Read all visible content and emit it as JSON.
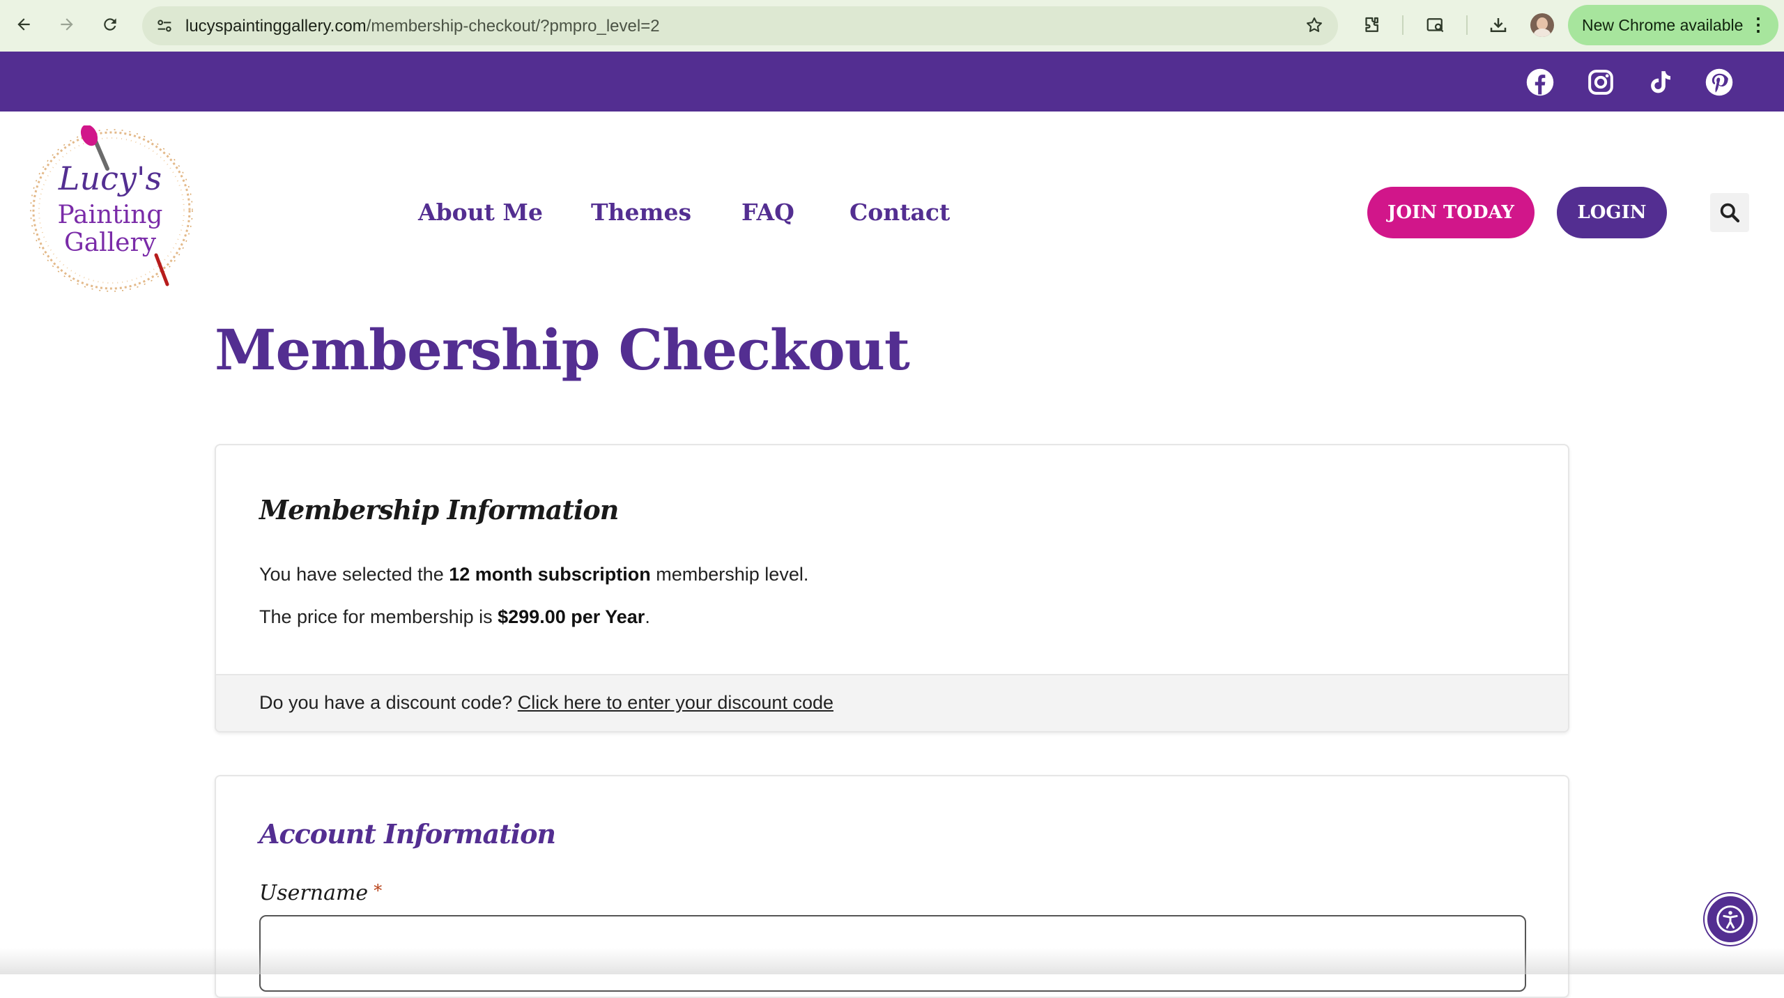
{
  "browser": {
    "url_domain": "lucyspaintinggallery.com",
    "url_path": "/membership-checkout/?pmpro_level=2",
    "update_chip_label": "New Chrome available",
    "icons": [
      "back-icon",
      "forward-icon",
      "reload-icon",
      "site-info-icon",
      "star-icon",
      "extensions-icon",
      "tab-search-icon",
      "download-icon",
      "profile-avatar",
      "more-menu-icon"
    ]
  },
  "social": {
    "icons": [
      "facebook-icon",
      "instagram-icon",
      "tiktok-icon",
      "pinterest-icon"
    ],
    "bar_color": "#532e91"
  },
  "header": {
    "logo": {
      "line1": "Lucy's",
      "line2": "Painting",
      "line3": "Gallery"
    },
    "nav": {
      "about": "About Me",
      "themes": "Themes",
      "faq": "FAQ",
      "contact": "Contact"
    },
    "join_label": "JOIN TODAY",
    "login_label": "LOGIN"
  },
  "colors": {
    "brand_purple": "#532e91",
    "brand_pink": "#d1168a"
  },
  "page": {
    "title": "Membership Checkout"
  },
  "membership_info": {
    "heading": "Membership Information",
    "selected_prefix": "You have selected the ",
    "level_name": "12 month subscription",
    "selected_suffix": " membership level.",
    "price_prefix": "The price for membership is ",
    "price": "$299.00 per Year",
    "price_suffix": ".",
    "discount_question": "Do you have a discount code? ",
    "discount_link": "Click here to enter your discount code"
  },
  "account_info": {
    "heading": "Account Information",
    "username_label": "Username",
    "required_mark": "*",
    "username_value": ""
  }
}
